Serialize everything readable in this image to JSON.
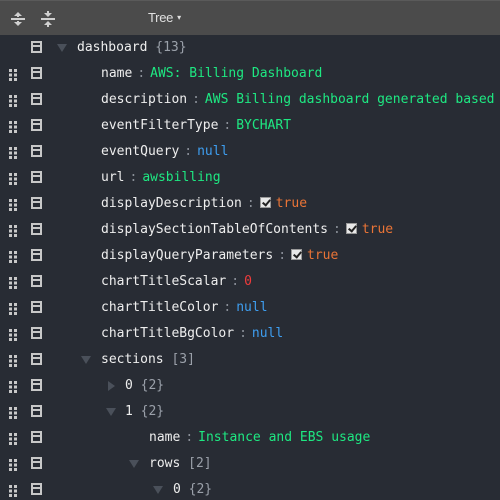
{
  "menu": {
    "expand_all_icon": "expand-all-icon",
    "collapse_all_icon": "collapse-all-icon",
    "mode_label": "Tree",
    "mode_caret": "▾"
  },
  "tree": {
    "root": {
      "key": "dashboard",
      "count": "{13}"
    },
    "fields": [
      {
        "key": "name",
        "value": "AWS: Billing Dashboard",
        "type": "string"
      },
      {
        "key": "description",
        "value": "AWS Billing dashboard generated based",
        "type": "string"
      },
      {
        "key": "eventFilterType",
        "value": "BYCHART",
        "type": "string"
      },
      {
        "key": "eventQuery",
        "value": "null",
        "type": "null"
      },
      {
        "key": "url",
        "value": "awsbilling",
        "type": "string"
      },
      {
        "key": "displayDescription",
        "value": "true",
        "type": "boolean",
        "checked": true
      },
      {
        "key": "displaySectionTableOfContents",
        "value": "true",
        "type": "boolean",
        "checked": true
      },
      {
        "key": "displayQueryParameters",
        "value": "true",
        "type": "boolean",
        "checked": true
      },
      {
        "key": "chartTitleScalar",
        "value": "0",
        "type": "number"
      },
      {
        "key": "chartTitleColor",
        "value": "null",
        "type": "null"
      },
      {
        "key": "chartTitleBgColor",
        "value": "null",
        "type": "null"
      }
    ],
    "sections": {
      "key": "sections",
      "count": "[3]"
    },
    "section0": {
      "key": "0",
      "count": "{2}"
    },
    "section1": {
      "key": "1",
      "count": "{2}"
    },
    "section1_name": {
      "key": "name",
      "value": "Instance and EBS usage"
    },
    "rows": {
      "key": "rows",
      "count": "[2]"
    },
    "row0": {
      "key": "0",
      "count": "{2}"
    },
    "separator": ":"
  }
}
